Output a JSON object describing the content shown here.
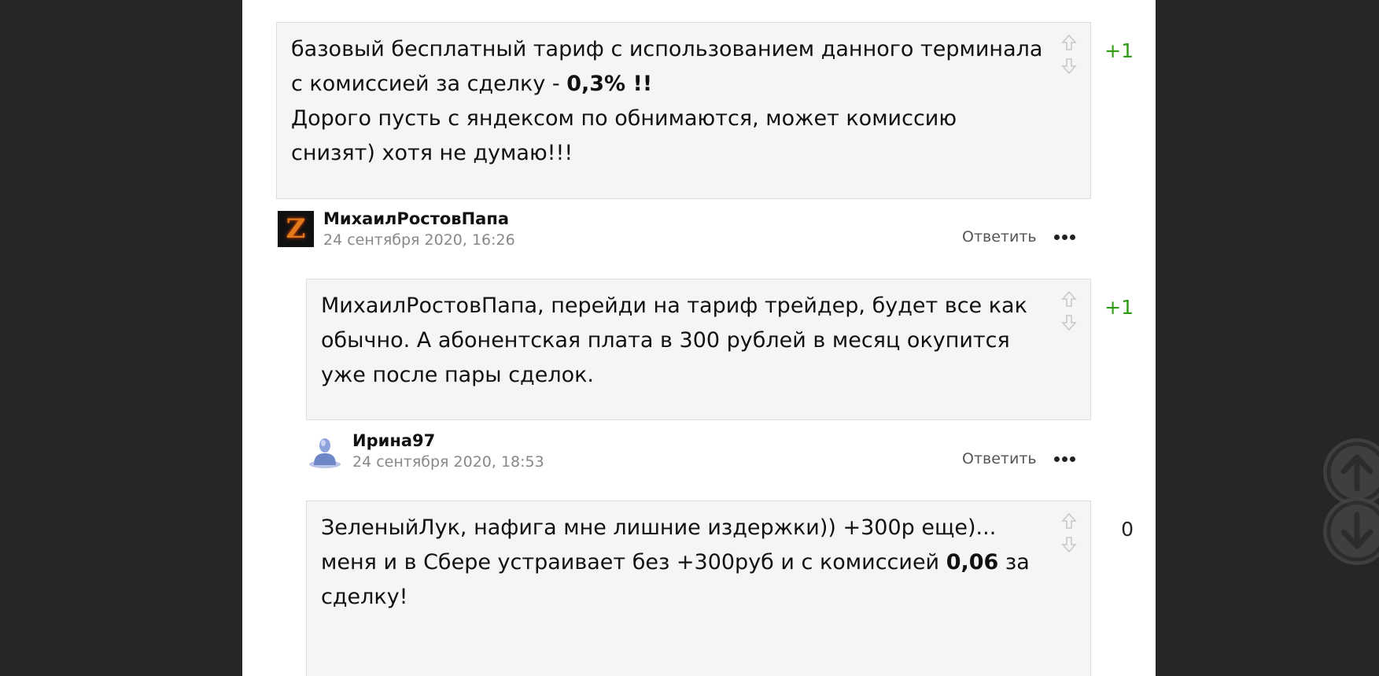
{
  "comments": [
    {
      "text_part1": "базовый бесплатный тариф с использованием данного терминала с комиссией за сделку - ",
      "bold": "0,3% !!",
      "text_part2": "Дорого пусть с яндексом по обнимаются, может комиссию снизят) хотя не думаю!!!",
      "score": "+1",
      "author": "МихаилРостовПапа",
      "date": "24 сентября 2020, 16:26",
      "avatar_letter": "Z"
    },
    {
      "text_part1": "МихаилРостовПапа, перейди на тариф трейдер, будет все как обычно. А абонентская плата в 300 рублей в месяц окупится уже после пары сделок.",
      "score": "+1",
      "author": "Ирина97",
      "date": "24 сентября 2020, 18:53"
    },
    {
      "text_part1": "ЗеленыйЛук, нафига мне лишние издержки)) +300р еще)... меня и в Сбере устраивает без +300руб и с комиссией ",
      "bold": "0,06",
      "text_part2": " за сделку!",
      "score": "0"
    }
  ],
  "actions": {
    "reply_label": "Ответить"
  },
  "colors": {
    "positive_score": "#2e9c12",
    "background": "#262626",
    "card_bg": "#f5f5f5"
  },
  "icons": {
    "upvote": "arrow-up-outline-icon",
    "downvote": "arrow-down-outline-icon",
    "more": "more-dots-icon",
    "scroll_up": "scroll-up-icon",
    "scroll_down": "scroll-down-icon"
  }
}
